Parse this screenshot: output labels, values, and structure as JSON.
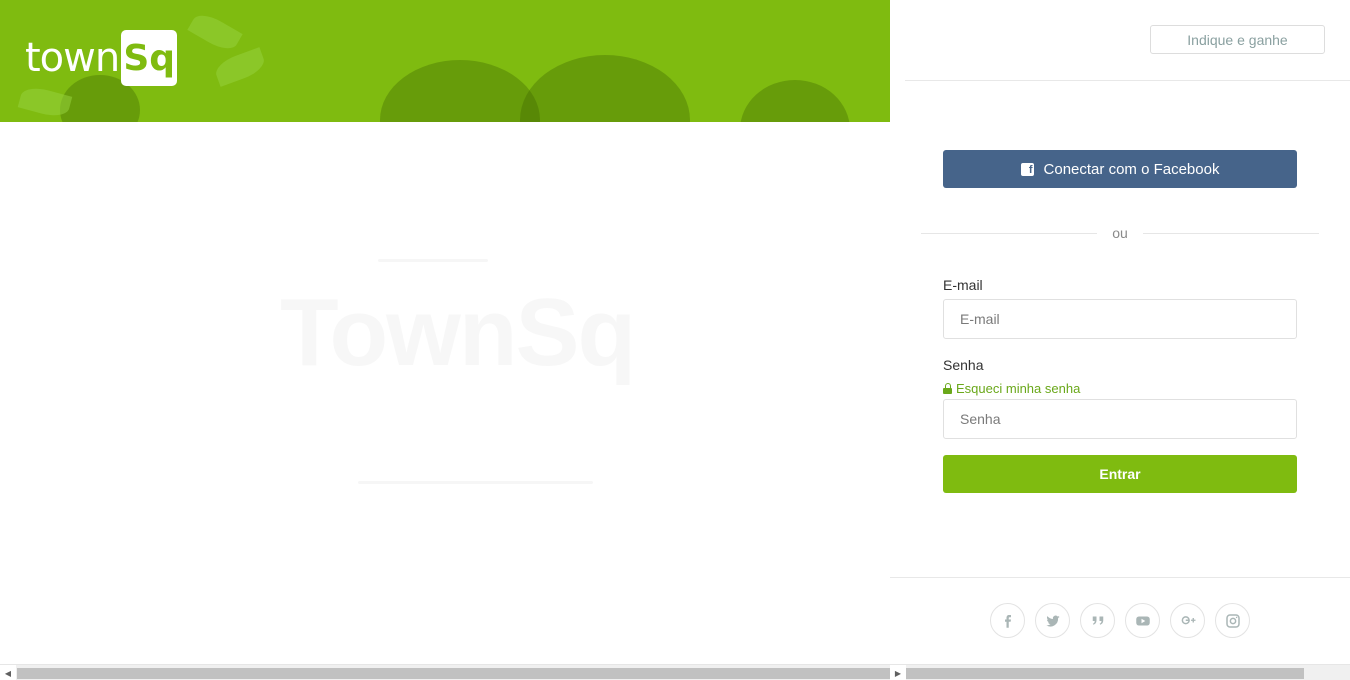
{
  "brand": {
    "logo_text": "town",
    "logo_box": "Sq",
    "accent_color": "#7fbb10",
    "facebook_color": "#46648a"
  },
  "hero": {
    "watermark": "TownSq"
  },
  "header": {
    "referral_button": "Indique e ganhe"
  },
  "login": {
    "facebook_button": "Conectar com o Facebook",
    "divider_text": "ou",
    "email_label": "E-mail",
    "email_placeholder": "E-mail",
    "email_value": "",
    "password_label": "Senha",
    "forgot_link": "Esqueci minha senha",
    "password_placeholder": "Senha",
    "password_value": "",
    "submit_button": "Entrar"
  },
  "footer": {
    "socials": [
      "facebook-icon",
      "twitter-icon",
      "blog-quote-icon",
      "youtube-icon",
      "google-plus-icon",
      "instagram-icon"
    ]
  }
}
